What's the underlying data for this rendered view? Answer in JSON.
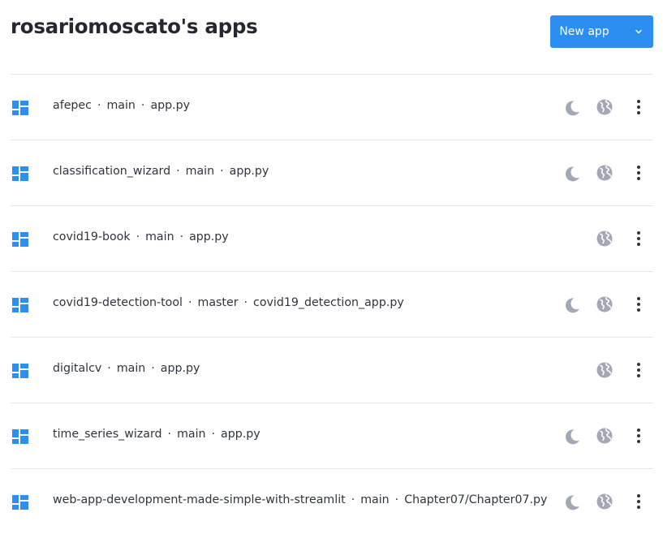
{
  "header": {
    "title": "rosariomoscato's apps",
    "new_app_label": "New app",
    "new_app_color": "#2b8ef0"
  },
  "apps": [
    {
      "name": "afepec",
      "branch": "main",
      "file": "app.py",
      "dark_mode_icon": true,
      "public_icon": true
    },
    {
      "name": "classification_wizard",
      "branch": "main",
      "file": "app.py",
      "dark_mode_icon": true,
      "public_icon": true
    },
    {
      "name": "covid19-book",
      "branch": "main",
      "file": "app.py",
      "dark_mode_icon": false,
      "public_icon": true
    },
    {
      "name": "covid19-detection-tool",
      "branch": "master",
      "file": "covid19_detection_app.py",
      "dark_mode_icon": true,
      "public_icon": true
    },
    {
      "name": "digitalcv",
      "branch": "main",
      "file": "app.py",
      "dark_mode_icon": false,
      "public_icon": true
    },
    {
      "name": "time_series_wizard",
      "branch": "main",
      "file": "app.py",
      "dark_mode_icon": true,
      "public_icon": true
    },
    {
      "name": "web-app-development-made-simple-with-streamlit",
      "branch": "main",
      "file": "Chapter07/Chapter07.py",
      "dark_mode_icon": true,
      "public_icon": true
    }
  ],
  "separator": "·",
  "icons": {
    "app": "app-grid-icon",
    "dark": "moon-icon",
    "public": "globe-icon",
    "menu": "kebab-menu-icon",
    "caret": "chevron-down-icon"
  },
  "colors": {
    "app_icon": "#2b8ef0",
    "status_icon": "#a3a8b4",
    "menu_icon": "#31333f"
  }
}
